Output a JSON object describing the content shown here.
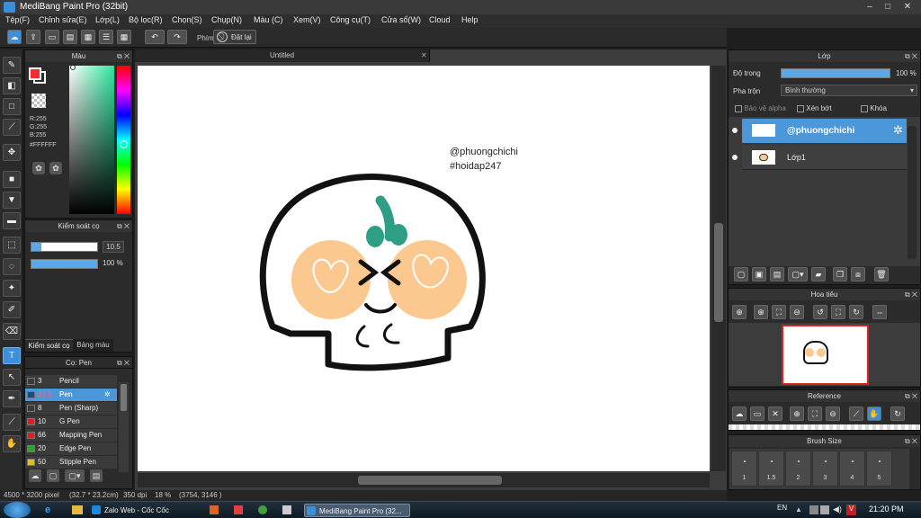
{
  "window": {
    "title": "MediBang Paint Pro (32bit)",
    "minimize": "‒",
    "maximize": "□",
    "close": "✕"
  },
  "menu": [
    "Tệp(F)",
    "Chỉnh sửa(E)",
    "Lớp(L)",
    "Bộ lọc(R)",
    "Chọn(S)",
    "Chụp(N)",
    "Màu (C)",
    "Xem(V)",
    "Công cụ(T)",
    "Cửa sổ(W)",
    "Cloud",
    "Help"
  ],
  "toolbar": {
    "shortcut_label": "Phím",
    "reset_label": "Đặt lại",
    "undo_icon": "undo-icon",
    "redo_icon": "redo-icon"
  },
  "color_panel": {
    "title": "Màu",
    "r": "R:255",
    "g": "G:255",
    "b": "B:255",
    "hex": "#FFFFFF",
    "fg": "#ff2a2a",
    "bg": "#ffffff"
  },
  "brush_control": {
    "title": "Kiểm soát cọ",
    "size_value": "10.5",
    "opacity_value": "100 %",
    "size_fraction": 0.15,
    "opacity_fraction": 1.0,
    "tab_active": "Kiểm soát cọ",
    "tab_other": "Bảng màu"
  },
  "brush_list": {
    "title": "Cọ: Pen",
    "items": [
      {
        "size": "3",
        "name": "Pencil",
        "color": "#3a3a3a"
      },
      {
        "size": "10.5",
        "name": "Pen",
        "color": "#1c4e7a",
        "selected": true
      },
      {
        "size": "8",
        "name": "Pen (Sharp)",
        "color": "#3a3a3a"
      },
      {
        "size": "10",
        "name": "G Pen",
        "color": "#e02020"
      },
      {
        "size": "66",
        "name": "Mapping Pen",
        "color": "#e02020"
      },
      {
        "size": "20",
        "name": "Edge Pen",
        "color": "#22aa22"
      },
      {
        "size": "50",
        "name": "Stipple Pen",
        "color": "#e0c020"
      }
    ]
  },
  "canvas": {
    "tab": "Untitled",
    "line1": "@phuongchichi",
    "line2": "#hoidap247"
  },
  "status": {
    "size": "4500 * 3200 pixel",
    "cm": "(32.7 * 23.2cm)",
    "dpi": "350 dpi",
    "zoom": "18 %",
    "coords": "(3754, 3146 )"
  },
  "layer_panel": {
    "title": "Lớp",
    "opacity_label": "Độ trong",
    "opacity_value": "100 %",
    "blend_label": "Pha trộn",
    "blend_value": "Bình thường",
    "protect_alpha": "Bảo vệ alpha",
    "clipping": "Xén bớt",
    "lock": "Khóa",
    "layers": [
      {
        "name": "@phuongchichi",
        "selected": true
      },
      {
        "name": "Lớp1",
        "selected": false
      }
    ]
  },
  "navigator": {
    "title": "Hoa tiêu"
  },
  "reference": {
    "title": "Reference"
  },
  "brush_size": {
    "title": "Brush Size",
    "labels": [
      "1",
      "1.5",
      "2",
      "3",
      "4",
      "5"
    ]
  },
  "taskbar": {
    "items": [
      {
        "label": "Zalo Web - Cốc Cốc",
        "active": false
      },
      {
        "label": "MediBang Paint Pro (32...",
        "active": true
      }
    ],
    "lang": "EN",
    "time": "21:20 PM"
  }
}
